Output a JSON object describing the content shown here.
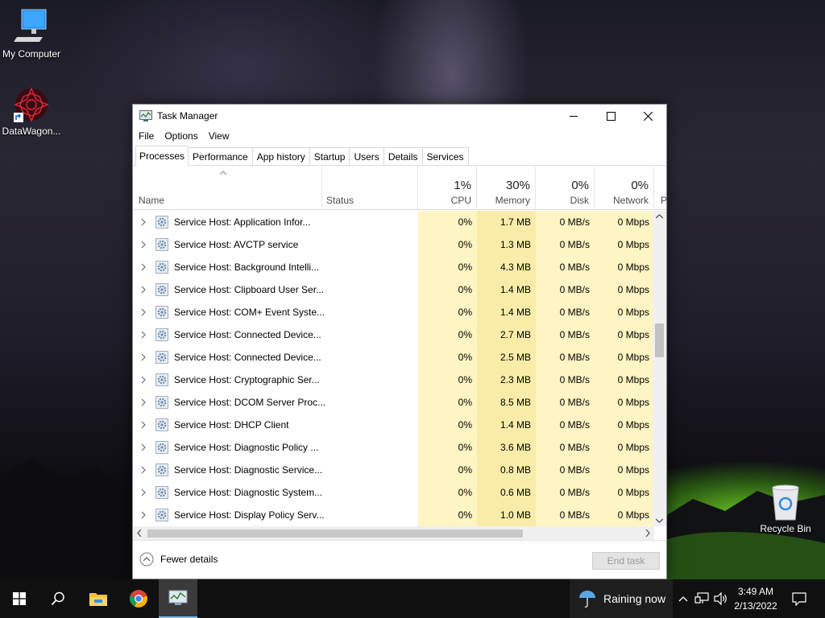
{
  "desktop": {
    "icons": [
      {
        "label": "My Computer"
      },
      {
        "label": "DataWagon..."
      },
      {
        "label": "Recycle Bin"
      }
    ]
  },
  "window": {
    "title": "Task Manager",
    "menu": [
      "File",
      "Options",
      "View"
    ],
    "tabs": [
      "Processes",
      "Performance",
      "App history",
      "Startup",
      "Users",
      "Details",
      "Services"
    ],
    "active_tab": "Processes",
    "columns": {
      "name": "Name",
      "status": "Status",
      "cpu": {
        "pct": "1%",
        "label": "CPU"
      },
      "memory": {
        "pct": "30%",
        "label": "Memory"
      },
      "disk": {
        "pct": "0%",
        "label": "Disk"
      },
      "network": {
        "pct": "0%",
        "label": "Network"
      },
      "power": {
        "label": "P"
      }
    },
    "rows": [
      {
        "name": "Service Host: Application Infor...",
        "cpu": "0%",
        "memory": "1.7 MB",
        "disk": "0 MB/s",
        "network": "0 Mbps"
      },
      {
        "name": "Service Host: AVCTP service",
        "cpu": "0%",
        "memory": "1.3 MB",
        "disk": "0 MB/s",
        "network": "0 Mbps"
      },
      {
        "name": "Service Host: Background Intelli...",
        "cpu": "0%",
        "memory": "4.3 MB",
        "disk": "0 MB/s",
        "network": "0 Mbps"
      },
      {
        "name": "Service Host: Clipboard User Ser...",
        "cpu": "0%",
        "memory": "1.4 MB",
        "disk": "0 MB/s",
        "network": "0 Mbps"
      },
      {
        "name": "Service Host: COM+ Event Syste...",
        "cpu": "0%",
        "memory": "1.4 MB",
        "disk": "0 MB/s",
        "network": "0 Mbps"
      },
      {
        "name": "Service Host: Connected Device...",
        "cpu": "0%",
        "memory": "2.7 MB",
        "disk": "0 MB/s",
        "network": "0 Mbps"
      },
      {
        "name": "Service Host: Connected Device...",
        "cpu": "0%",
        "memory": "2.5 MB",
        "disk": "0 MB/s",
        "network": "0 Mbps"
      },
      {
        "name": "Service Host: Cryptographic Ser...",
        "cpu": "0%",
        "memory": "2.3 MB",
        "disk": "0 MB/s",
        "network": "0 Mbps"
      },
      {
        "name": "Service Host: DCOM Server Proc...",
        "cpu": "0%",
        "memory": "8.5 MB",
        "disk": "0 MB/s",
        "network": "0 Mbps"
      },
      {
        "name": "Service Host: DHCP Client",
        "cpu": "0%",
        "memory": "1.4 MB",
        "disk": "0 MB/s",
        "network": "0 Mbps"
      },
      {
        "name": "Service Host: Diagnostic Policy ...",
        "cpu": "0%",
        "memory": "3.6 MB",
        "disk": "0 MB/s",
        "network": "0 Mbps"
      },
      {
        "name": "Service Host: Diagnostic Service...",
        "cpu": "0%",
        "memory": "0.8 MB",
        "disk": "0 MB/s",
        "network": "0 Mbps"
      },
      {
        "name": "Service Host: Diagnostic System...",
        "cpu": "0%",
        "memory": "0.6 MB",
        "disk": "0 MB/s",
        "network": "0 Mbps"
      },
      {
        "name": "Service Host: Display Policy Serv...",
        "cpu": "0%",
        "memory": "1.0 MB",
        "disk": "0 MB/s",
        "network": "0 Mbps"
      }
    ],
    "footer": {
      "fewer_details": "Fewer details",
      "end_task": "End task"
    }
  },
  "taskbar": {
    "weather": "Raining now",
    "time": "3:49 AM",
    "date": "2/13/2022"
  },
  "colors": {
    "cpu_heat": "#fff4c4",
    "memory_heat": "#f9eca8",
    "taskbar": "#101010",
    "active_task_underline": "#76b9ed"
  }
}
